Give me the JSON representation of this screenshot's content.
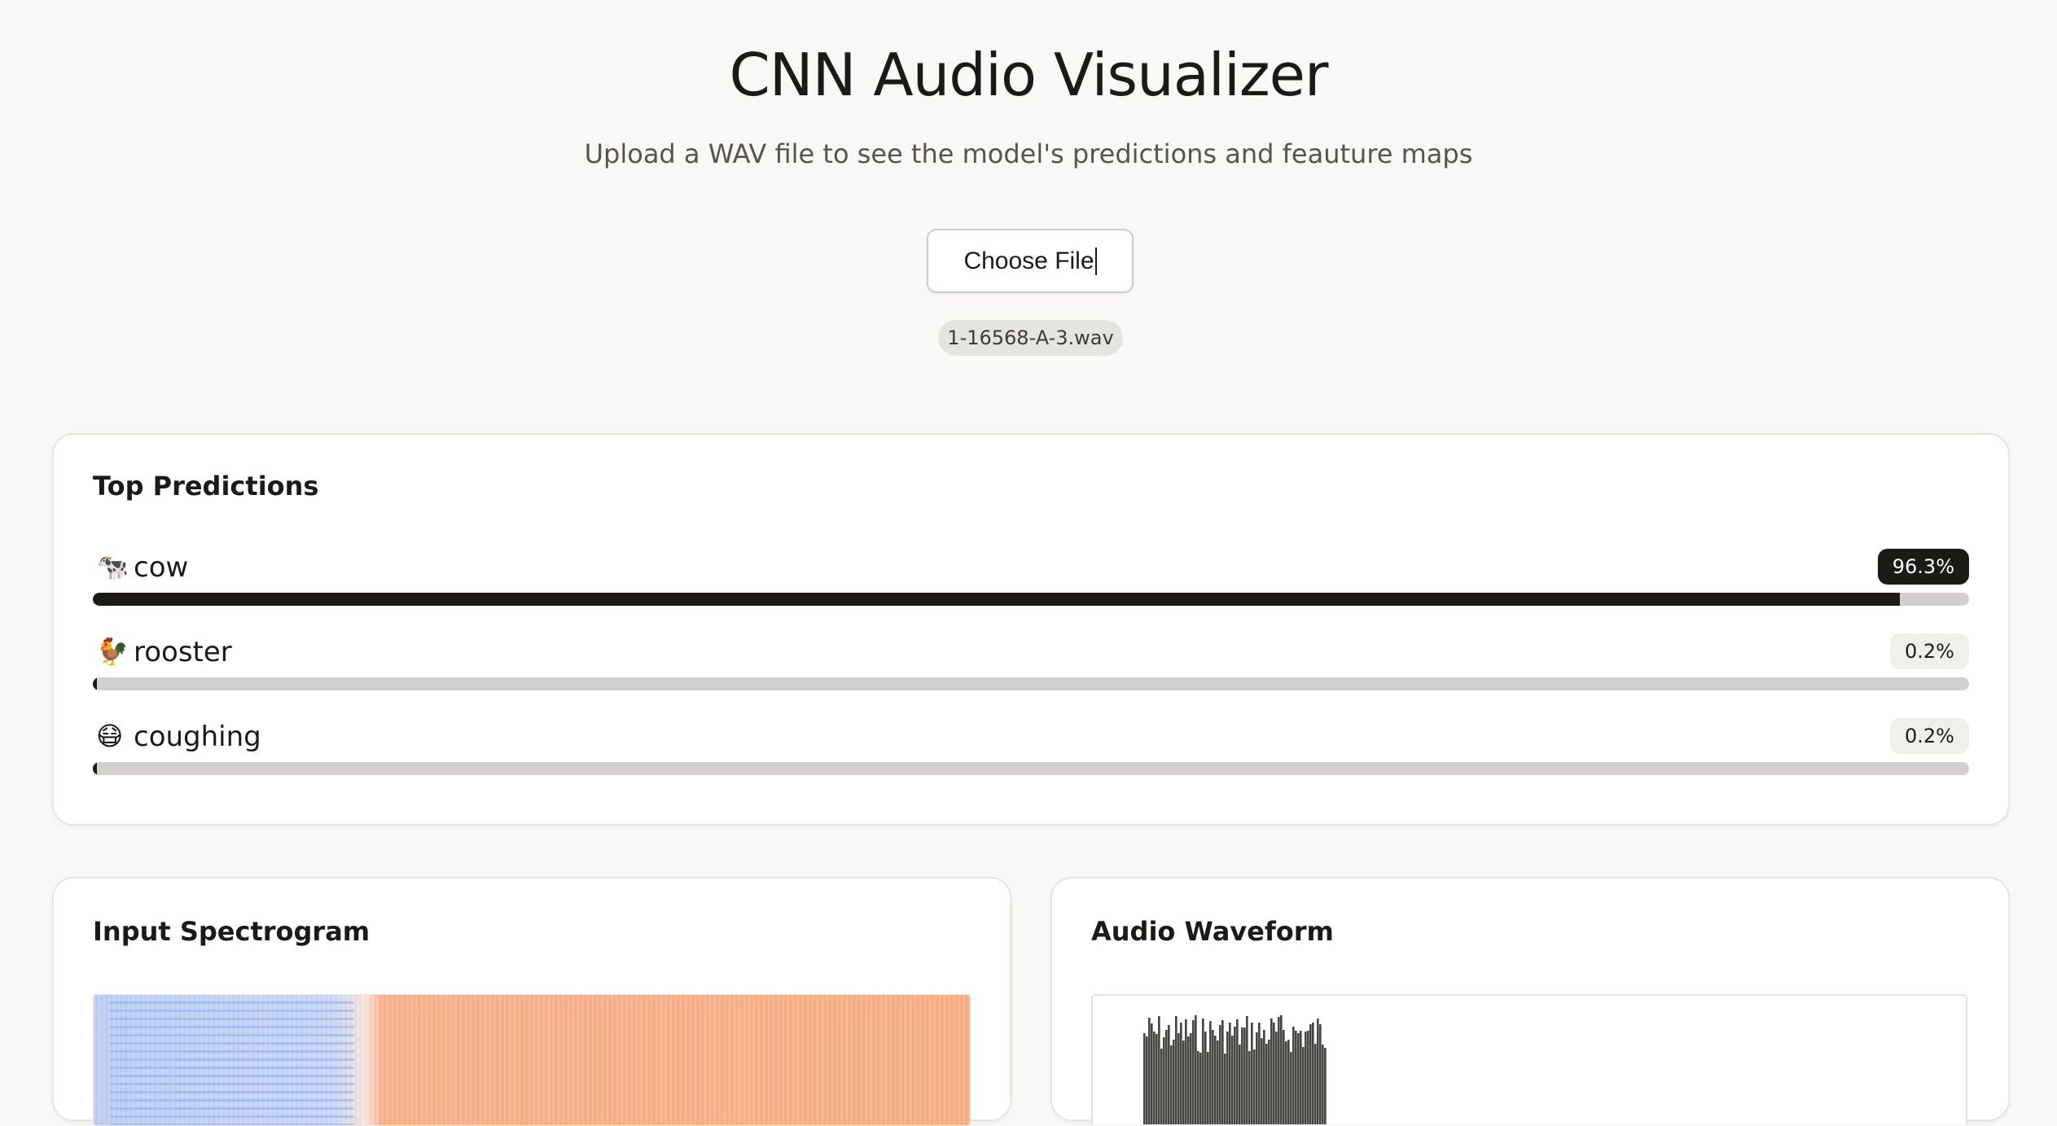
{
  "header": {
    "title": "CNN Audio Visualizer",
    "subtitle": "Upload a WAV file to see the model's predictions and feauture maps"
  },
  "upload": {
    "button_label": "Choose File",
    "file_name": "1-16568-A-3.wav"
  },
  "predictions": {
    "title": "Top Predictions",
    "items": [
      {
        "emoji": "🐄",
        "icon": "cow-icon",
        "label": "cow",
        "percent_text": "96.3%",
        "value": 0.963
      },
      {
        "emoji": "🐓",
        "icon": "rooster-icon",
        "label": "rooster",
        "percent_text": "0.2%",
        "value": 0.002
      },
      {
        "emoji": "😷",
        "icon": "coughing-face-icon",
        "label": "coughing",
        "percent_text": "0.2%",
        "value": 0.002
      }
    ]
  },
  "spectrogram": {
    "title": "Input Spectrogram",
    "colors": {
      "low": "#a9c7f5",
      "mid": "#ffffff",
      "high": "#f6ae86"
    }
  },
  "waveform": {
    "title": "Audio Waveform",
    "color": "#45433f"
  },
  "colors": {
    "background": "#f9f8f6",
    "bar_fill": "#1c1a17",
    "bar_track": "#d1d0ce"
  }
}
